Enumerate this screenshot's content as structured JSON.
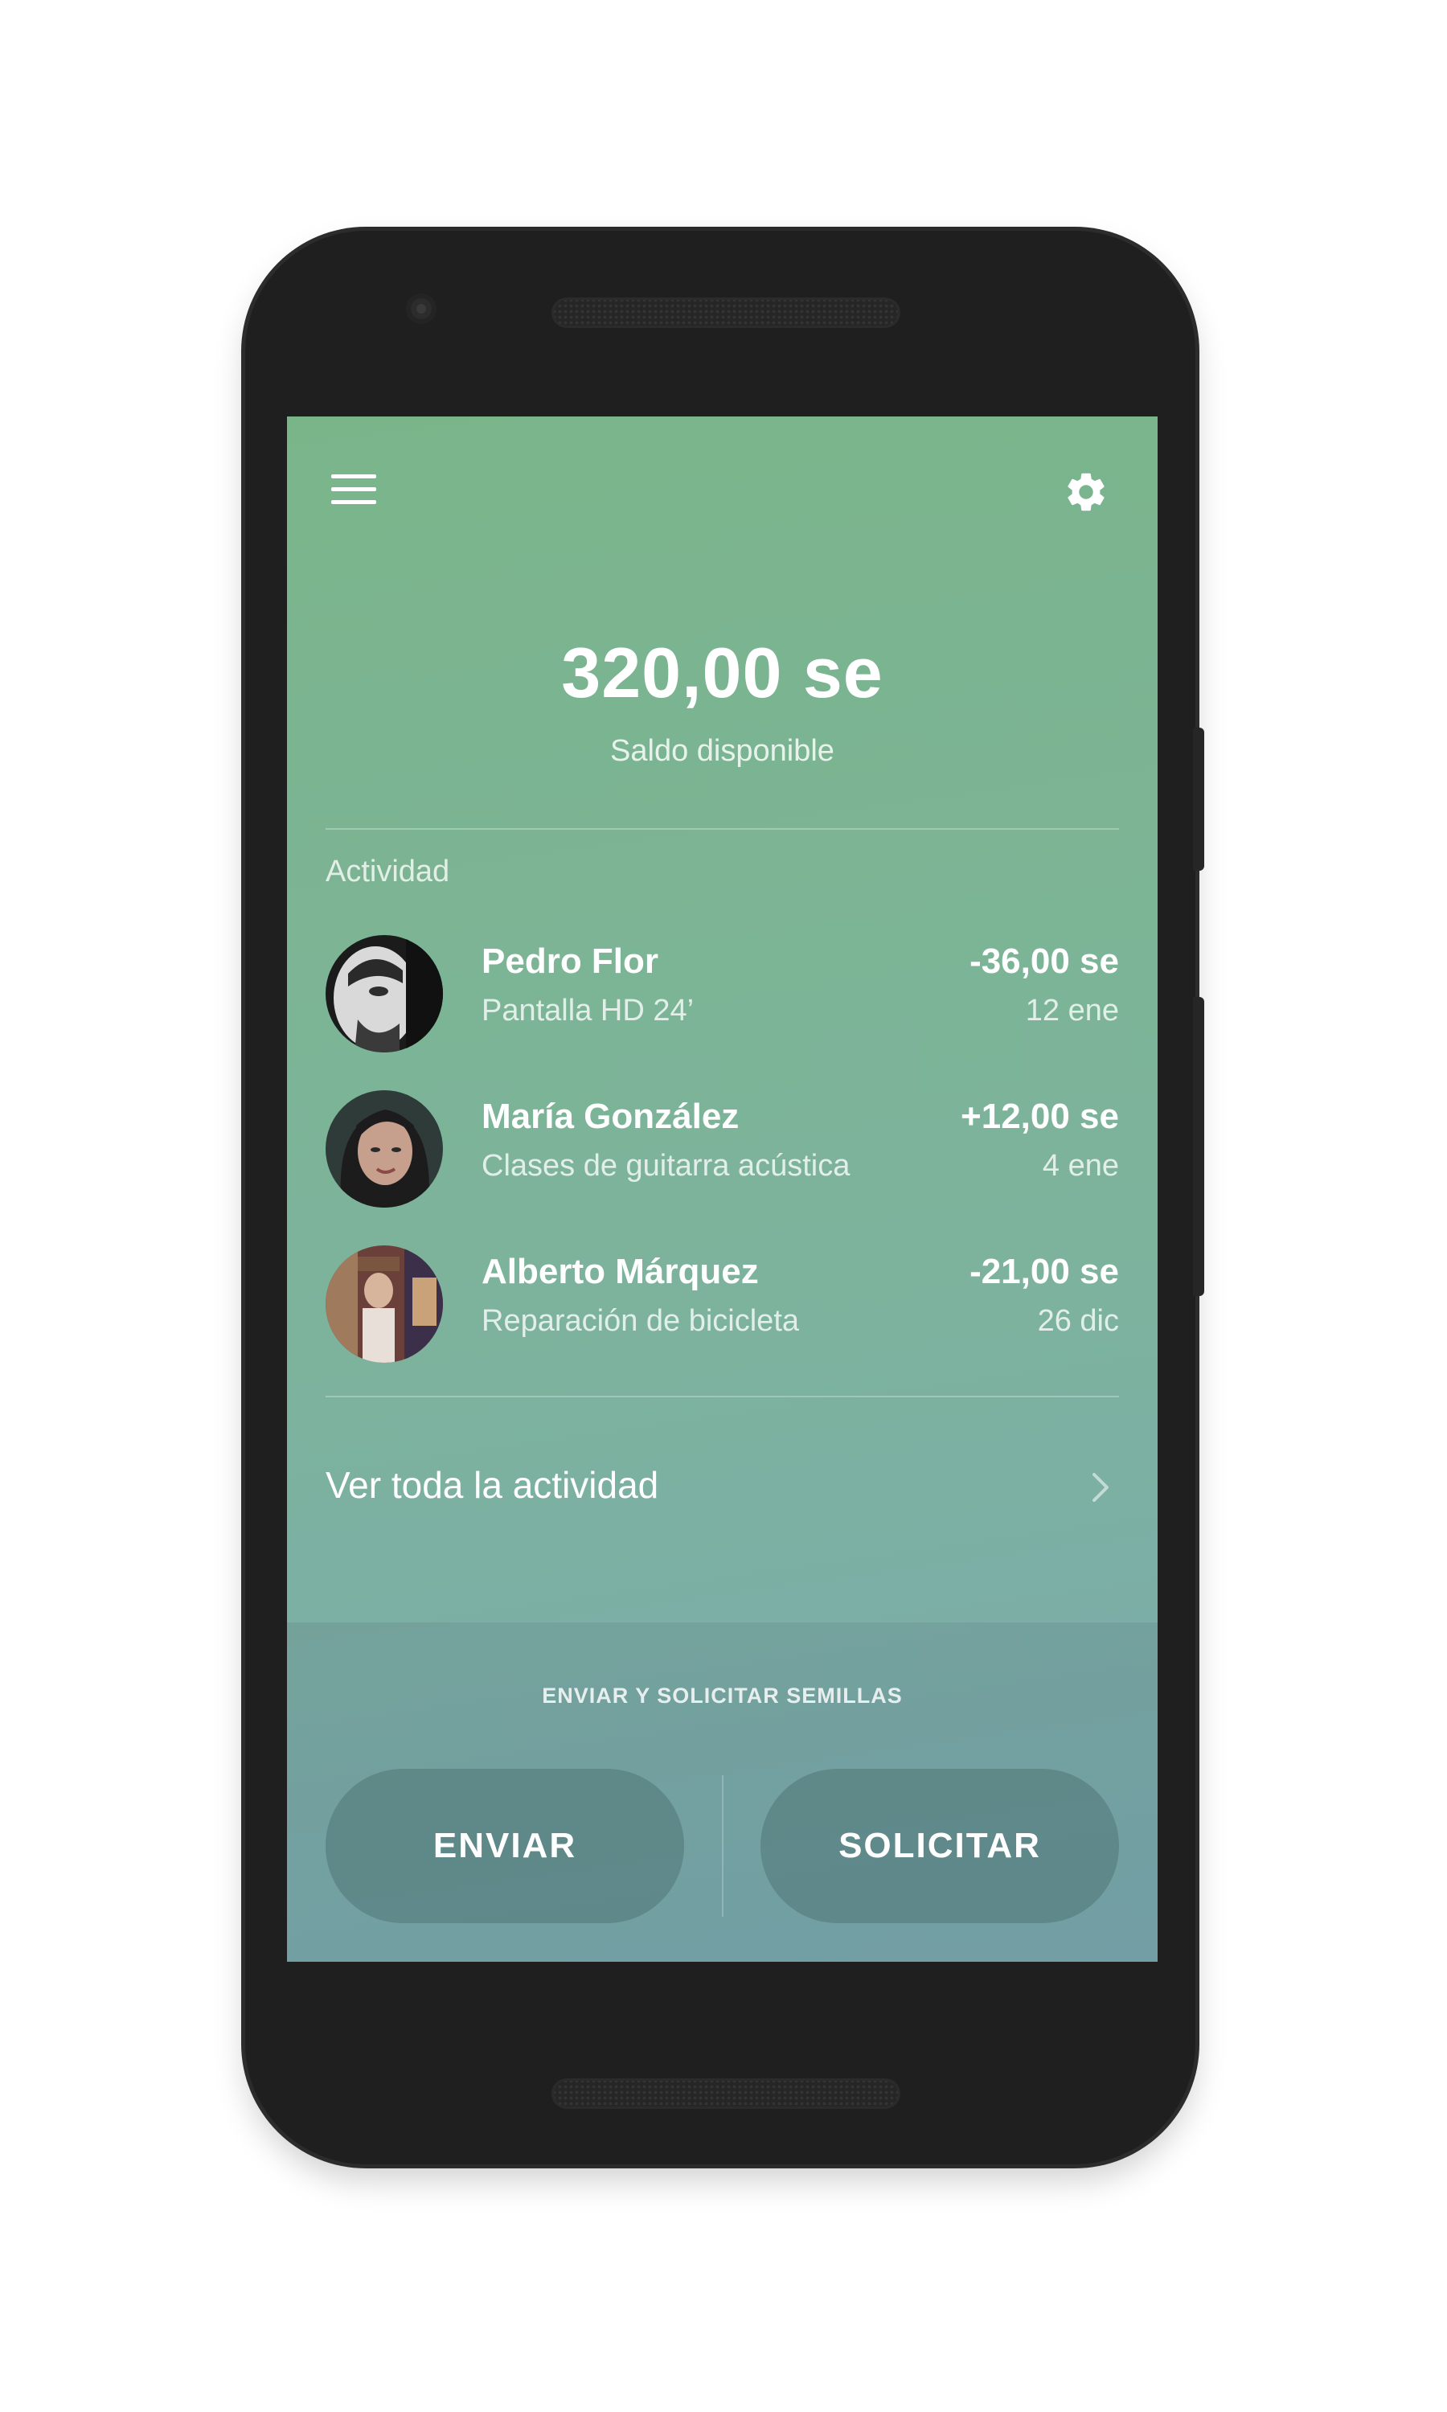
{
  "header": {
    "menu_icon": "hamburger-menu-icon",
    "settings_icon": "gear-icon"
  },
  "balance": {
    "amount": "320,00 se",
    "label": "Saldo disponible"
  },
  "activity": {
    "title": "Actividad",
    "items": [
      {
        "name": "Pedro Flor",
        "description": "Pantalla HD 24’",
        "amount": "-36,00 se",
        "date": "12 ene"
      },
      {
        "name": "María González",
        "description": "Clases de guitarra acústica",
        "amount": "+12,00 se",
        "date": "4 ene"
      },
      {
        "name": "Alberto Márquez",
        "description": "Reparación de bicicleta",
        "amount": "-21,00 se",
        "date": "26 dic"
      }
    ],
    "see_all": "Ver toda la actividad",
    "see_all_icon": "chevron-right-icon"
  },
  "actions": {
    "title": "ENVIAR Y SOLICITAR SEMILLAS",
    "send_label": "ENVIAR",
    "request_label": "SOLICITAR"
  },
  "colors": {
    "screen_top": "#7ab58a",
    "screen_bottom": "#7aaab0",
    "phone_body": "#1f1f1f",
    "text": "#ffffff"
  }
}
